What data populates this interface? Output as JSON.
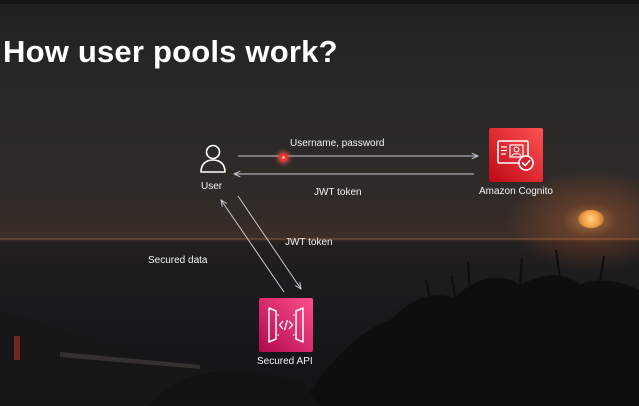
{
  "slide": {
    "title": "How user pools work?",
    "nodes": {
      "user": "User",
      "cognito": "Amazon Cognito",
      "api": "Secured API"
    },
    "flows": {
      "credentials": "Username, password",
      "jwt_return": "JWT token",
      "jwt_to_api": "JWT token",
      "secured_data": "Secured data"
    },
    "icons": [
      "user-icon",
      "cognito-id-card-icon",
      "api-gateway-icon",
      "laser-pointer-icon"
    ]
  }
}
